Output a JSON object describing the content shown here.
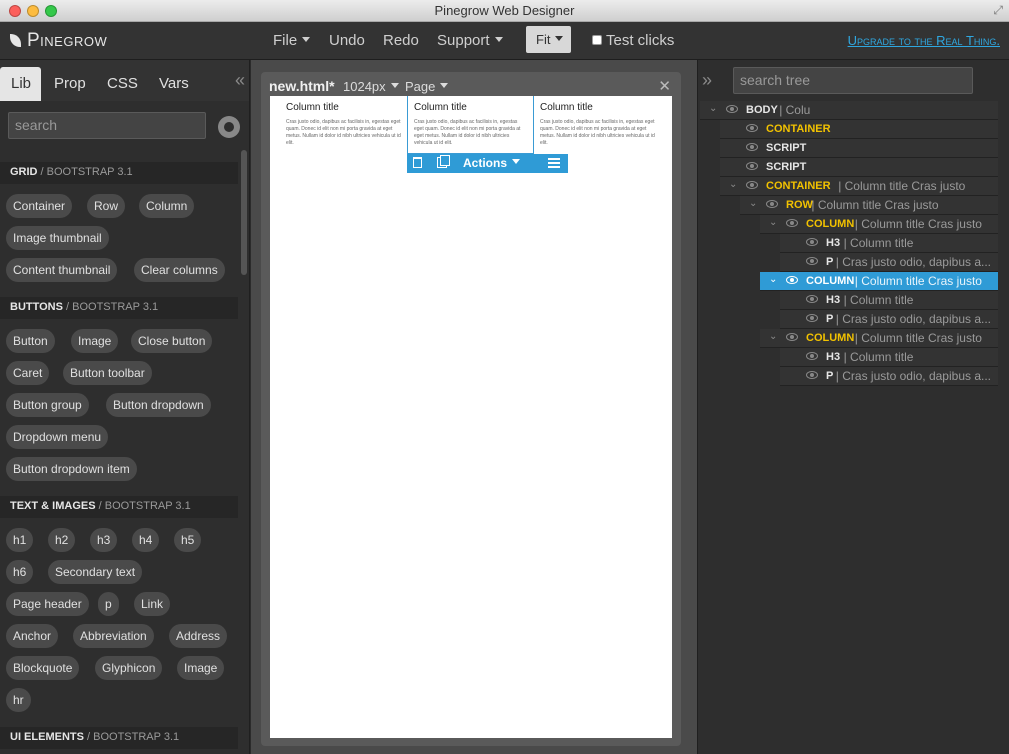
{
  "window": {
    "title": "Pinegrow Web Designer"
  },
  "toolbar": {
    "logo": "Pinegrow",
    "file": "File",
    "undo": "Undo",
    "redo": "Redo",
    "support": "Support",
    "fit": "Fit",
    "test_clicks": "Test clicks",
    "upgrade": "Upgrade to the Real Thing."
  },
  "left": {
    "tabs": [
      "Lib",
      "Prop",
      "CSS",
      "Vars"
    ],
    "active_tab": "Lib",
    "search_placeholder": "search",
    "sections": [
      {
        "title": "GRID",
        "sub": " / BOOTSTRAP 3.1",
        "items": [
          "Container",
          "Row",
          "Column",
          "Image thumbnail",
          "Content thumbnail",
          "Clear columns"
        ]
      },
      {
        "title": "BUTTONS",
        "sub": " / BOOTSTRAP 3.1",
        "items": [
          "Button",
          "Image",
          "Close button",
          "Caret",
          "Button toolbar",
          "Button group",
          "Button dropdown",
          "Dropdown menu",
          "Button dropdown item"
        ]
      },
      {
        "title": "TEXT & IMAGES",
        "sub": " / BOOTSTRAP 3.1",
        "items": [
          "h1",
          "h2",
          "h3",
          "h4",
          "h5",
          "h6",
          "Secondary text",
          "Page header",
          "p",
          "Link",
          "Anchor",
          "Abbreviation",
          "Address",
          "Blockquote",
          "Glyphicon",
          "Image",
          "hr"
        ]
      },
      {
        "title": "UI ELEMENTS",
        "sub": " / BOOTSTRAP 3.1",
        "items": []
      }
    ]
  },
  "canvas": {
    "file_name": "new.html*",
    "size": "1024px",
    "page": "Page",
    "columns": [
      {
        "title": "Column title",
        "text": "Cras justo odio, dapibus ac facilisis in, egestas eget quam. Donec id elit non mi porta gravida at eget metus. Nullam id dolor id nibh ultricies vehicula ut id elit."
      },
      {
        "title": "Column title",
        "text": "Cras justo odio, dapibus ac facilisis in, egestas eget quam. Donec id elit non mi porta gravida at eget metus. Nullam id dolor id nibh ultricies vehicula ut id elit."
      },
      {
        "title": "Column title",
        "text": "Cras justo odio, dapibus ac facilisis in, egestas eget quam. Donec id elit non mi porta gravida at eget metus. Nullam id dolor id nibh ultricies vehicula ut id elit."
      }
    ],
    "actions_label": "Actions"
  },
  "tree": {
    "search_placeholder": "search tree",
    "nodes": [
      {
        "tag": "BODY",
        "text": "Colu",
        "highlight": false,
        "selected": false
      },
      {
        "tag": "CONTAINER",
        "text": "",
        "highlight": true,
        "selected": false
      },
      {
        "tag": "SCRIPT",
        "text": "",
        "highlight": false,
        "selected": false
      },
      {
        "tag": "SCRIPT",
        "text": "",
        "highlight": false,
        "selected": false
      },
      {
        "tag": "CONTAINER",
        "text": "Column title Cras justo",
        "highlight": true,
        "selected": false
      },
      {
        "tag": "ROW",
        "text": "Column title Cras justo",
        "highlight": true,
        "selected": false
      },
      {
        "tag": "COLUMN",
        "text": "Column title Cras justo",
        "highlight": true,
        "selected": false
      },
      {
        "tag": "H3",
        "text": "Column title",
        "highlight": false,
        "selected": false
      },
      {
        "tag": "P",
        "text": "Cras justo odio, dapibus a...",
        "highlight": false,
        "selected": false
      },
      {
        "tag": "COLUMN",
        "text": "Column title Cras justo",
        "highlight": true,
        "selected": true
      },
      {
        "tag": "H3",
        "text": "Column title",
        "highlight": false,
        "selected": false
      },
      {
        "tag": "P",
        "text": "Cras justo odio, dapibus a...",
        "highlight": false,
        "selected": false
      },
      {
        "tag": "COLUMN",
        "text": "Column title Cras justo",
        "highlight": true,
        "selected": false
      },
      {
        "tag": "H3",
        "text": "Column title",
        "highlight": false,
        "selected": false
      },
      {
        "tag": "P",
        "text": "Cras justo odio, dapibus a...",
        "highlight": false,
        "selected": false
      }
    ]
  },
  "colors": {
    "accent": "#2f9bd6",
    "tag_highlight": "#f2c200",
    "link": "#2fa7e0"
  }
}
